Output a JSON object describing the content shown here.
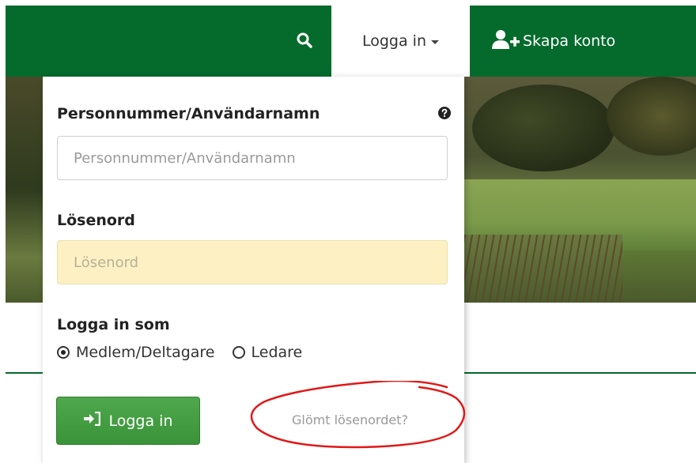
{
  "navbar": {
    "search_icon": "search-icon",
    "login_label": "Logga in",
    "create_account_label": "Skapa konto",
    "create_account_icon": "add-user-icon",
    "color": "#046b2c"
  },
  "login_form": {
    "username_label": "Personnummer/Användarnamn",
    "username_placeholder": "Personnummer/Användarnamn",
    "password_label": "Lösenord",
    "password_placeholder": "Lösenord",
    "login_as_label": "Logga in som",
    "roles": [
      {
        "label": "Medlem/Deltagare",
        "selected": true
      },
      {
        "label": "Ledare",
        "selected": false
      }
    ],
    "submit_label": "Logga in",
    "forgot_label": "Glömt lösenordet?"
  },
  "colors": {
    "brand_green": "#046b2c",
    "button_green": "#46a044",
    "password_bg": "#fdf1c3",
    "annotation_red": "#e01818"
  }
}
